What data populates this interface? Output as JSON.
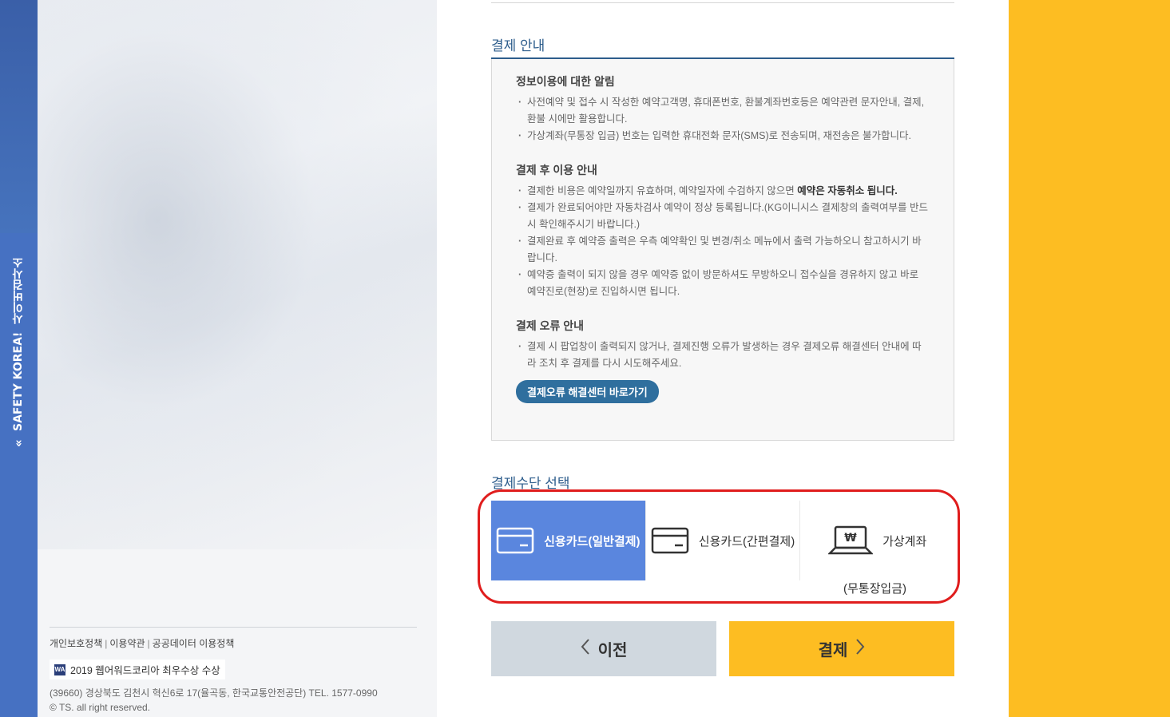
{
  "sidebar": {
    "brand": "SAFETY KOREA!",
    "sub": "사이버검사소",
    "toggle_icon": "«"
  },
  "footer": {
    "links": [
      "개인보호정책",
      "이용약관",
      "공공데이터 이용정책"
    ],
    "award": "2019 웹어워드코리아 최우수상 수상",
    "award_icon": "WA",
    "address": "(39660) 경상북도 김천시 혁신6로 17(율곡동, 한국교통안전공단) TEL. 1577-0990",
    "copyright": "© TS. all right reserved."
  },
  "payment_info": {
    "title": "결제 안내",
    "sections": [
      {
        "heading": "정보이용에 대한 알림",
        "items": [
          "사전예약 및 접수 시 작성한 예약고객명, 휴대폰번호, 환불계좌번호등은 예약관련 문자안내, 결제, 환불 시에만 활용합니다.",
          "가상계좌(무통장 입금) 번호는 입력한 휴대전화 문자(SMS)로 전송되며, 재전송은 불가합니다."
        ]
      },
      {
        "heading": "결제 후 이용 안내",
        "items": [
          "결제한 비용은 예약일까지 유효하며, 예약일자에 수검하지 않으면 ",
          "결제가 완료되어야만 자동차검사 예약이 정상 등록됩니다.(KG이니시스 결제창의 출력여부를 반드시 확인해주시기 바랍니다.)",
          "결제완료 후 예약증 출력은 우측 예약확인 및 변경/취소 메뉴에서 출력 가능하오니 참고하시기 바랍니다.",
          "예약증 출력이 되지 않을 경우 예약증 없이 방문하셔도 무방하오니 접수실을 경유하지 않고 바로 예약진로(현장)로 진입하시면 됩니다."
        ],
        "bold_tail": "예약은 자동취소 됩니다."
      },
      {
        "heading": "결제 오류 안내",
        "items": [
          "결제 시 팝업창이 출력되지 않거나, 결제진행 오류가 발생하는 경우 결제오류 해결센터 안내에 따라 조치 후 결제를 다시 시도해주세요."
        ]
      }
    ],
    "error_center_button": "결제오류 해결센터 바로가기"
  },
  "payment_method": {
    "title": "결제수단 선택",
    "options": [
      {
        "label": "신용카드(일반결제)",
        "icon": "credit-card-icon",
        "selected": true
      },
      {
        "label": "신용카드(간편결제)",
        "icon": "credit-card-icon",
        "selected": false
      },
      {
        "label": "가상계좌",
        "icon": "laptop-won-icon",
        "selected": false
      }
    ],
    "virtual_sub": "(무통장입금)"
  },
  "actions": {
    "prev": "이전",
    "pay": "결제"
  },
  "colors": {
    "accent_blue": "#2d5d8c",
    "selected_blue": "#5a86de",
    "yellow": "#fdbd22",
    "highlight_red": "#e01d1d"
  }
}
